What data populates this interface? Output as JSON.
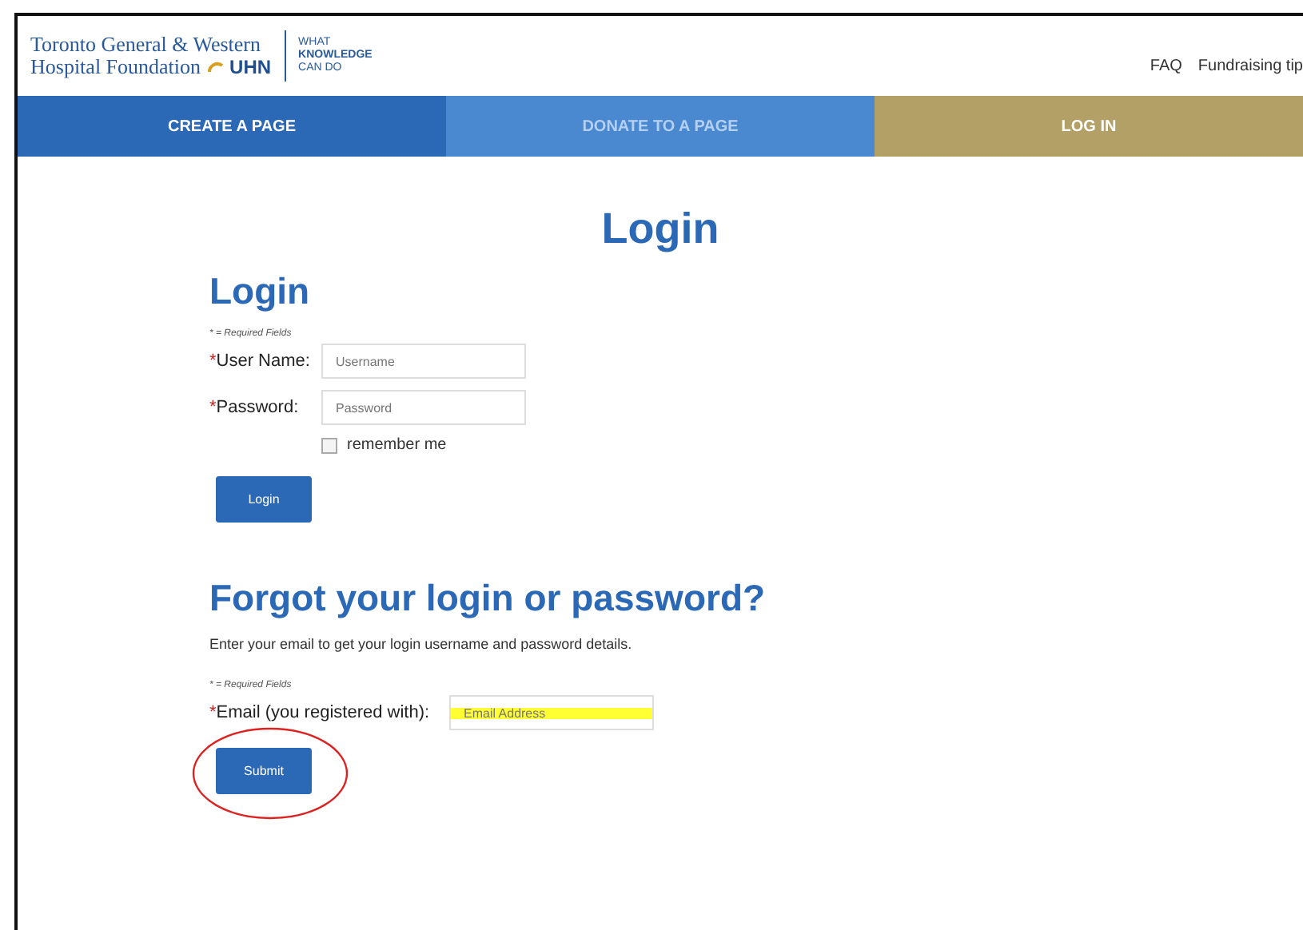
{
  "header": {
    "logo_lines": [
      "Toronto General & Western",
      "Hospital Foundation"
    ],
    "logo_mark": "UHN",
    "tagline": [
      "WHAT",
      "KNOWLEDGE",
      "CAN DO"
    ],
    "links": [
      "FAQ",
      "Fundraising tip"
    ]
  },
  "nav": [
    {
      "label": "CREATE A PAGE",
      "color": "#2b68b5",
      "disabled": false
    },
    {
      "label": "DONATE TO A PAGE",
      "color": "#4a88cf",
      "disabled": true
    },
    {
      "label": "LOG IN",
      "color": "#b3a066",
      "disabled": false
    }
  ],
  "page_title": "Login",
  "login": {
    "heading": "Login",
    "required_note": "* = Required Fields",
    "fields": [
      {
        "marker": "*",
        "label": "User Name:",
        "placeholder": "Username"
      },
      {
        "marker": "*",
        "label": "Password:",
        "placeholder": "Password"
      }
    ],
    "remember": {
      "label": "remember me",
      "checked": false
    },
    "button": "Login"
  },
  "forgot": {
    "heading": "Forgot your login or password?",
    "intro": "Enter your email to get your login username and password details.",
    "required_note": "* = Required Fields",
    "field": {
      "marker": "*",
      "label": "Email (you registered with):",
      "placeholder": "Email Address",
      "highlighted": true
    },
    "button": "Submit",
    "button_circled": true
  }
}
